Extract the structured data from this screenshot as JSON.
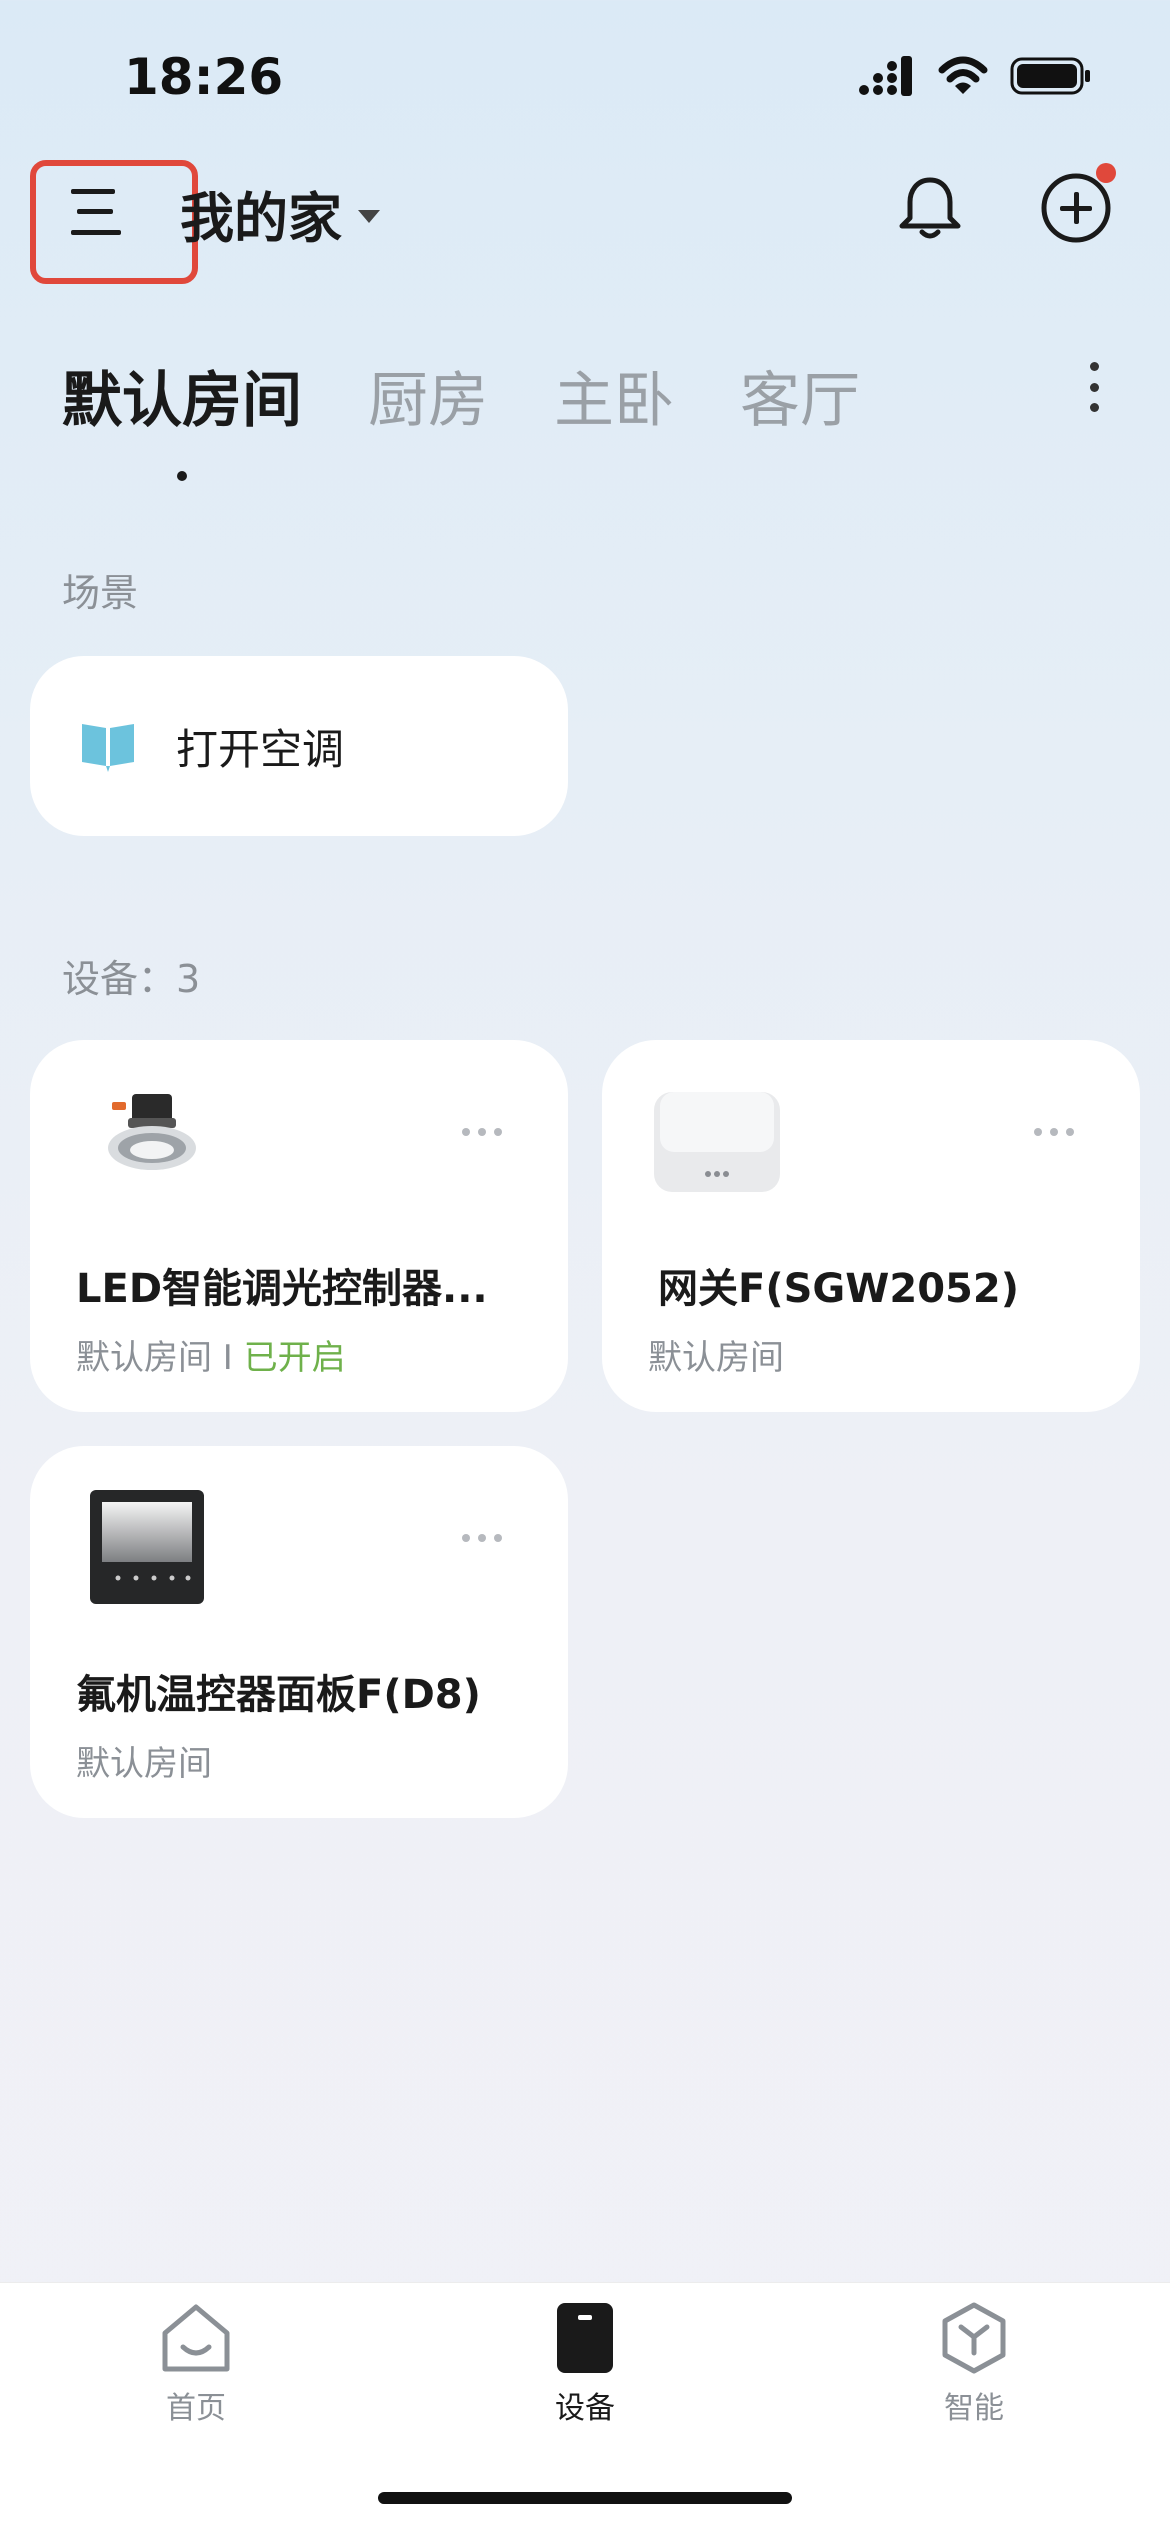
{
  "status_bar": {
    "time": "18:26"
  },
  "header": {
    "home_name": "我的家"
  },
  "tabs": [
    {
      "label": "默认房间",
      "active": true
    },
    {
      "label": "厨房",
      "active": false
    },
    {
      "label": "主卧",
      "active": false
    },
    {
      "label": "客厅",
      "active": false
    }
  ],
  "scenes": {
    "label": "场景",
    "items": [
      {
        "name": "打开空调",
        "icon": "book-icon"
      }
    ]
  },
  "devices": {
    "label": "设备：3",
    "items": [
      {
        "name": "LED智能调光控制器...",
        "room": "默认房间",
        "separator": " I ",
        "status": "已开启",
        "icon": "downlight-icon"
      },
      {
        "name": "网关F(SGW2052)",
        "room": "默认房间",
        "icon": "gateway-icon"
      },
      {
        "name": "氟机温控器面板F(D8)",
        "room": "默认房间",
        "icon": "thermostat-panel-icon"
      }
    ]
  },
  "bottom_nav": [
    {
      "label": "首页",
      "icon": "home-icon",
      "active": false
    },
    {
      "label": "设备",
      "icon": "device-icon",
      "active": true
    },
    {
      "label": "智能",
      "icon": "smart-cube-icon",
      "active": false
    }
  ],
  "colors": {
    "accent_red": "#e0483b",
    "status_green": "#6fb14b",
    "scene_icon": "#6cc3dd"
  }
}
